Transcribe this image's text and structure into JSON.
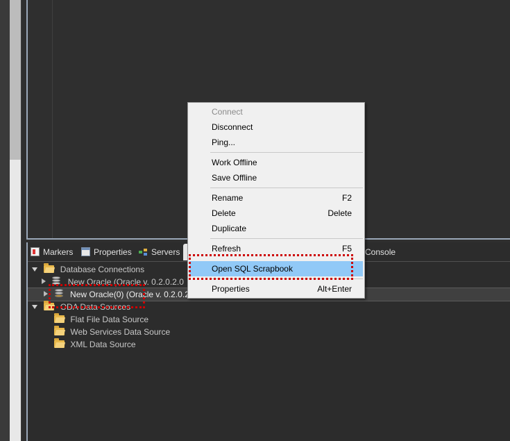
{
  "views": {
    "tabs": [
      {
        "label": "Markers",
        "icon": "markers-icon"
      },
      {
        "label": "Properties",
        "icon": "properties-icon"
      },
      {
        "label": "Servers",
        "icon": "servers-icon"
      },
      {
        "label": "Console",
        "icon": "console-icon"
      }
    ]
  },
  "tree": {
    "database_connections": "Database Connections",
    "connections": [
      "New Oracle (Oracle v. 0.2.0.2.0",
      "New Oracle(0) (Oracle v. 0.2.0.2"
    ],
    "oda_data_sources": "ODA Data Sources",
    "oda_children": [
      "Flat File Data Source",
      "Web Services Data Source",
      "XML Data Source"
    ]
  },
  "context_menu": {
    "items": [
      {
        "label": "Connect",
        "accel": "",
        "disabled": true
      },
      {
        "label": "Disconnect",
        "accel": ""
      },
      {
        "label": "Ping...",
        "accel": ""
      },
      {
        "label": "Work Offline",
        "accel": ""
      },
      {
        "label": "Save Offline",
        "accel": ""
      },
      {
        "label": "Rename",
        "accel": "F2"
      },
      {
        "label": "Delete",
        "accel": "Delete"
      },
      {
        "label": "Duplicate",
        "accel": ""
      },
      {
        "label": "Refresh",
        "accel": "F5"
      },
      {
        "label": "Open SQL Scrapbook",
        "accel": "",
        "highlighted": true
      },
      {
        "label": "Properties",
        "accel": "Alt+Enter"
      }
    ]
  },
  "colors": {
    "highlight": "#91c9f7",
    "annotation": "#cc0000"
  }
}
